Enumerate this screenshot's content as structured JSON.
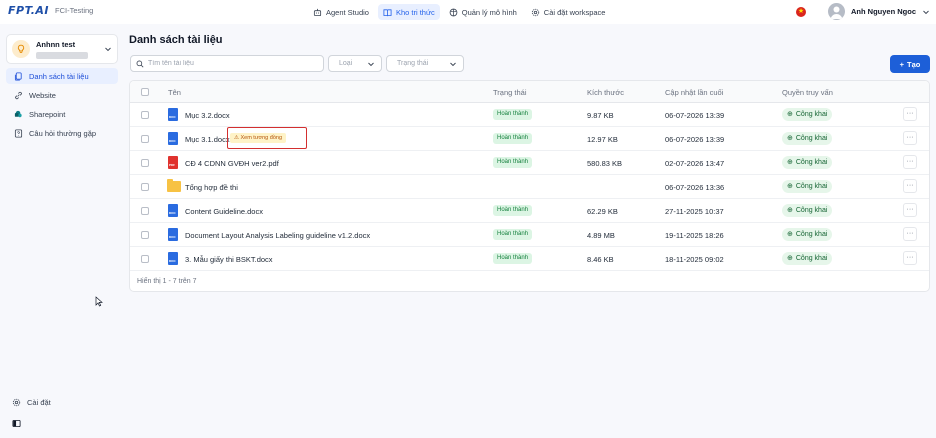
{
  "app": {
    "logo_text": "FPT.AI",
    "logo_sub": "FCI-Testing"
  },
  "topnav": [
    {
      "label": "Agent Studio",
      "icon": "robot-icon",
      "active": false
    },
    {
      "label": "Kho tri thức",
      "icon": "book-icon",
      "active": true
    },
    {
      "label": "Quản lý mô hình",
      "icon": "model-icon",
      "active": false
    },
    {
      "label": "Cài đặt workspace",
      "icon": "gear-icon",
      "active": false
    }
  ],
  "user": {
    "name": "Anh Nguyen Ngoc"
  },
  "workspace": {
    "name": "Anhnn test"
  },
  "sidebar": {
    "items": [
      {
        "label": "Danh sách tài liệu",
        "icon": "documents-icon",
        "active": true
      },
      {
        "label": "Website",
        "icon": "link-icon",
        "active": false
      },
      {
        "label": "Sharepoint",
        "icon": "sharepoint-icon",
        "active": false
      },
      {
        "label": "Câu hỏi thường gặp",
        "icon": "faq-icon",
        "active": false
      }
    ],
    "settings_label": "Cài đặt"
  },
  "main": {
    "title": "Danh sách tài liệu",
    "search_placeholder": "Tìm tên tài liệu",
    "filter_type": "Loại",
    "filter_status": "Trạng thái",
    "create_label": "Tạo"
  },
  "table": {
    "headers": [
      "Tên",
      "Trạng thái",
      "Kích thước",
      "Cập nhật lần cuối",
      "Quyền truy vấn"
    ],
    "rows": [
      {
        "name": "Mục 3.2.docx",
        "kind": "docx",
        "status": "Hoàn thành",
        "size": "9.87 KB",
        "updated": "06-07-2026 13:39",
        "access": "Công khai"
      },
      {
        "name": "Mục 3.1.docx",
        "kind": "docx",
        "status": "Hoàn thành",
        "size": "12.97 KB",
        "updated": "06-07-2026 13:39",
        "access": "Công khai",
        "badge": "Xem tương đồng"
      },
      {
        "name": "CĐ 4 CDNN GVĐH ver2.pdf",
        "kind": "pdf",
        "status": "Hoàn thành",
        "size": "580.83 KB",
        "updated": "02-07-2026 13:47",
        "access": "Công khai"
      },
      {
        "name": "Tổng hợp đề thi",
        "kind": "folder",
        "status": "",
        "size": "",
        "updated": "06-07-2026 13:36",
        "access": "Công khai"
      },
      {
        "name": "Content Guideline.docx",
        "kind": "docx",
        "status": "Hoàn thành",
        "size": "62.29 KB",
        "updated": "27-11-2025 10:37",
        "access": "Công khai"
      },
      {
        "name": "Document Layout Analysis Labeling guideline v1.2.docx",
        "kind": "docx",
        "status": "Hoàn thành",
        "size": "4.89 MB",
        "updated": "19-11-2025 18:26",
        "access": "Công khai"
      },
      {
        "name": "3. Mẫu giấy thi BSKT.docx",
        "kind": "docx",
        "status": "Hoàn thành",
        "size": "8.46 KB",
        "updated": "18-11-2025 09:02",
        "access": "Công khai"
      }
    ],
    "footer": "Hiển thị 1 - 7 trên 7"
  },
  "colors": {
    "accent": "#1d5fd8",
    "status_green": "#15803d",
    "highlight_red": "#d32f2f"
  }
}
